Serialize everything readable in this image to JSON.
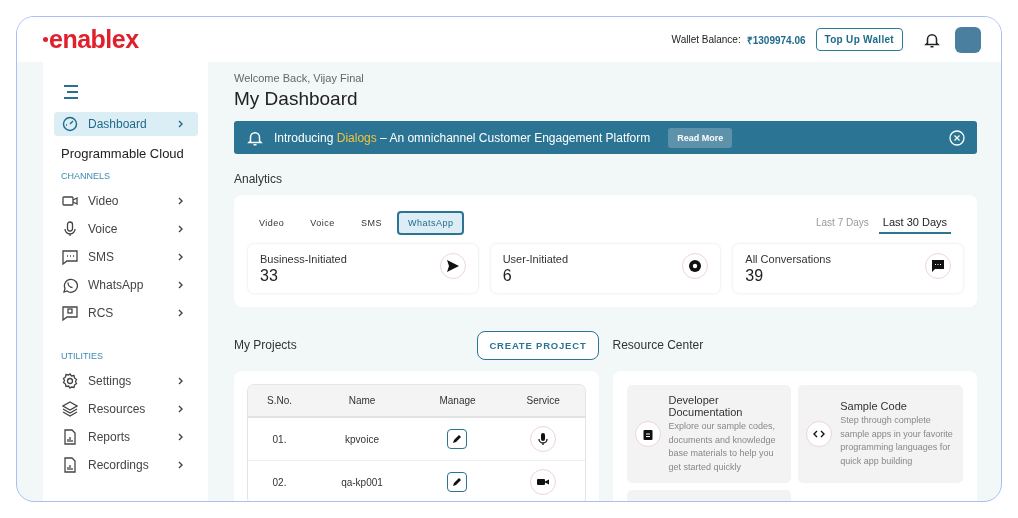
{
  "header": {
    "logo": "enablex",
    "wallet_label": "Wallet Balance:",
    "wallet_amount": "₹1309974.06",
    "top_up_button": "Top Up Wallet"
  },
  "sidebar": {
    "items": [
      {
        "label": "Dashboard",
        "selected": true
      }
    ],
    "section_title": "Programmable Cloud",
    "groups": [
      {
        "title": "CHANNELS",
        "items": [
          {
            "label": "Video",
            "selected": false
          },
          {
            "label": "Voice",
            "selected": false
          },
          {
            "label": "SMS",
            "selected": false
          },
          {
            "label": "WhatsApp",
            "selected": false
          },
          {
            "label": "RCS",
            "selected": false
          }
        ]
      },
      {
        "title": "UTILITIES",
        "items": [
          {
            "label": "Settings",
            "selected": false
          },
          {
            "label": "Resources",
            "selected": false
          },
          {
            "label": "Reports",
            "selected": false
          },
          {
            "label": "Recordings",
            "selected": false
          }
        ]
      }
    ]
  },
  "welcome": "Welcome Back, Vijay Final",
  "page_title": "My Dashboard",
  "banner": {
    "before": "Introducing ",
    "highlight": "Dialogs",
    "after": " – An omnichannel Customer Engagement Platform",
    "button": "Read More"
  },
  "analytics": {
    "title": "Analytics",
    "tabs": [
      {
        "label": "Video",
        "selected": false
      },
      {
        "label": "Voice",
        "selected": false
      },
      {
        "label": "SMS",
        "selected": false
      },
      {
        "label": "WhatsApp",
        "selected": true
      }
    ],
    "ranges": [
      {
        "label": "Last 7 Days",
        "selected": false
      },
      {
        "label": "Last 30 Days",
        "selected": true
      }
    ],
    "stats": [
      {
        "label": "Business-Initiated",
        "value": "33"
      },
      {
        "label": "User-Initiated",
        "value": "6"
      },
      {
        "label": "All Conversations",
        "value": "39"
      }
    ]
  },
  "projects": {
    "title": "My Projects",
    "create_button": "CREATE PROJECT",
    "columns": [
      "S.No.",
      "Name",
      "Manage",
      "Service"
    ],
    "rows": [
      {
        "sno": "01.",
        "name": "kpvoice",
        "kind": "voice"
      },
      {
        "sno": "02.",
        "name": "qa-kp001",
        "kind": "video"
      }
    ]
  },
  "resources": {
    "title": "Resource Center",
    "cards": [
      {
        "title": "Developer Documentation",
        "text": "Explore our sample codes, documents and knowledge base materials to help you get started quickly"
      },
      {
        "title": "Sample Code",
        "text": "Step through complete sample apps in your favorite programming languages for quick app building"
      }
    ]
  }
}
